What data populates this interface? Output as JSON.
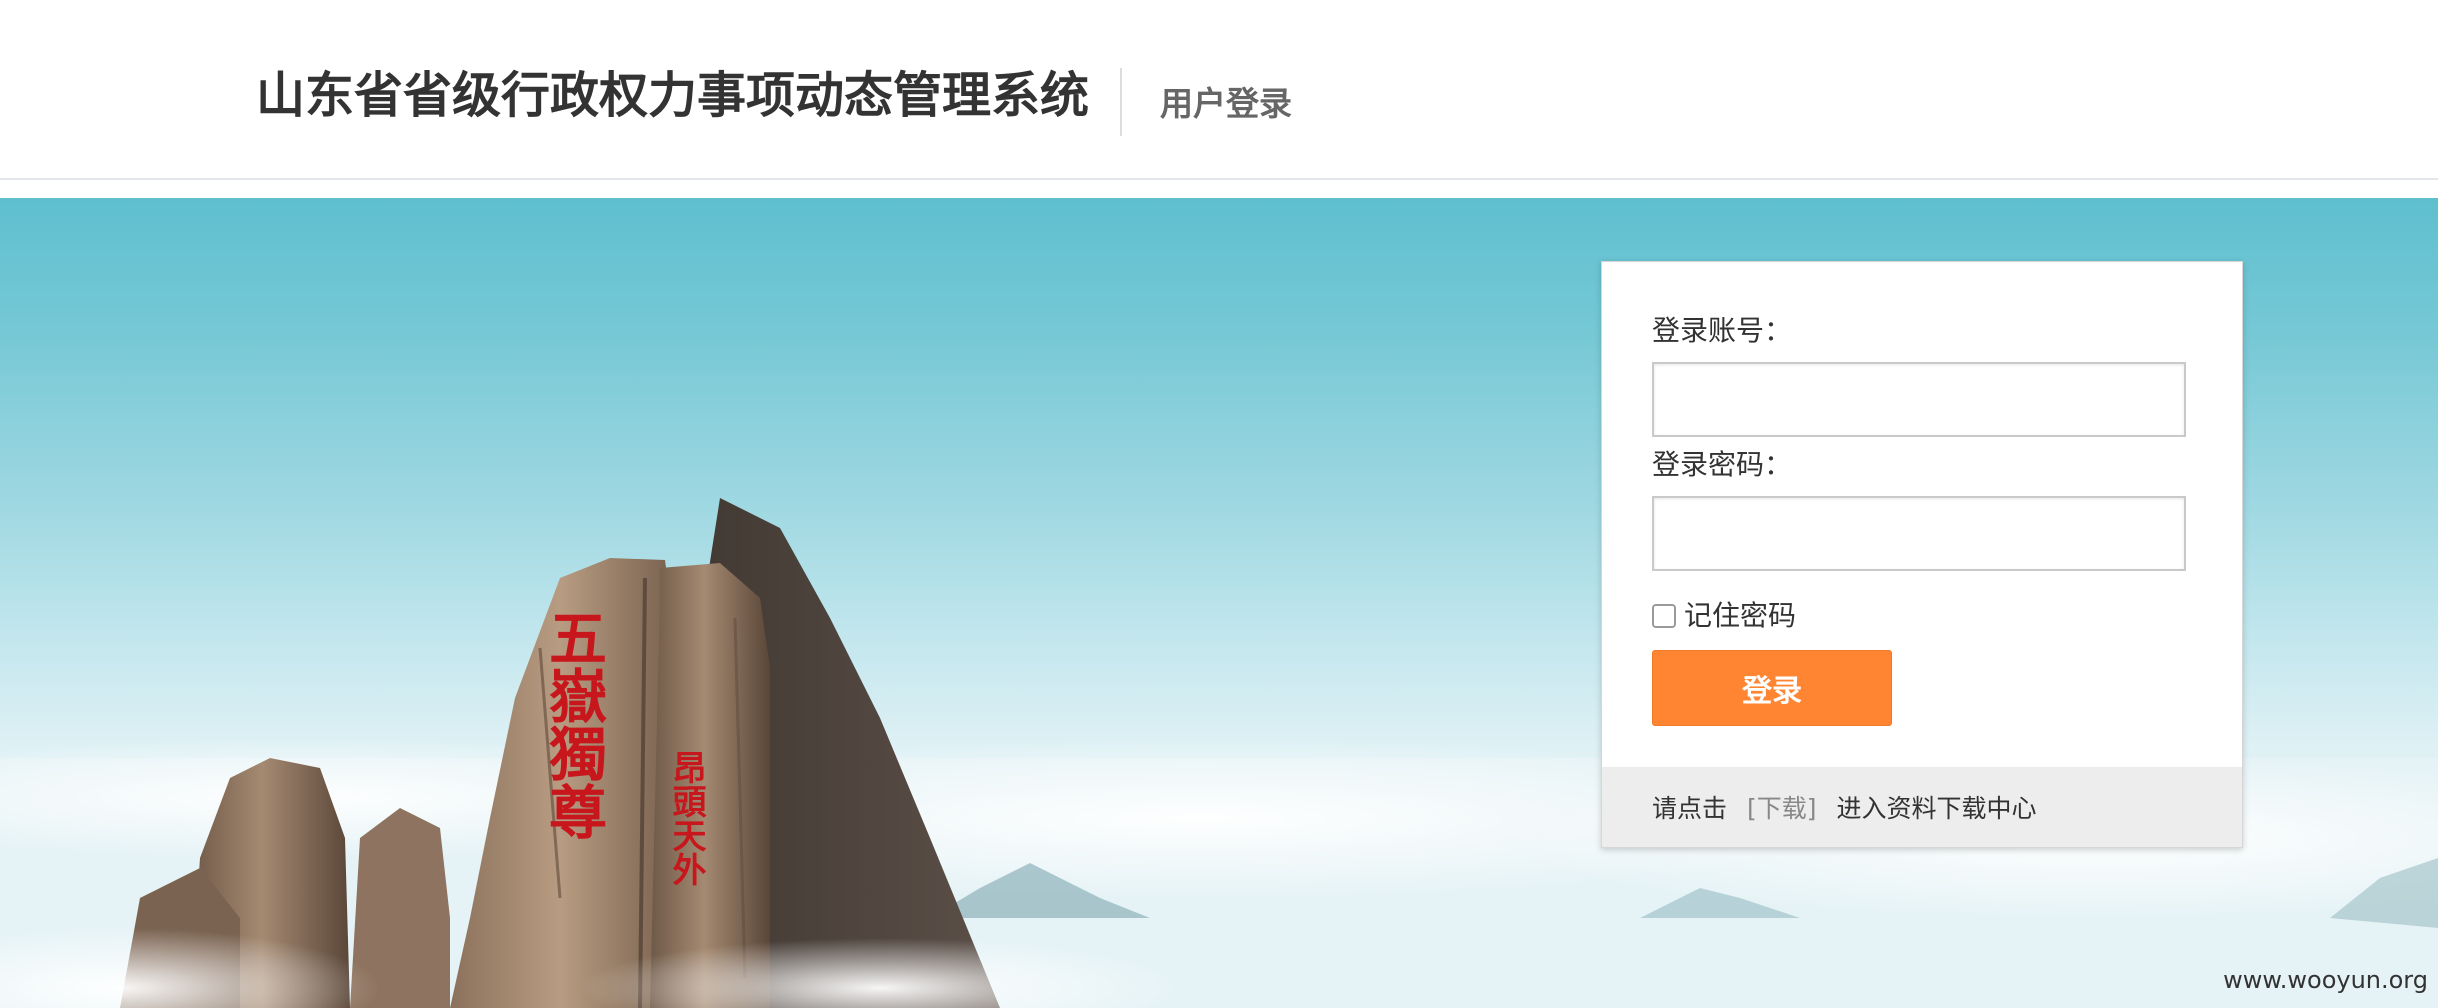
{
  "header": {
    "title": "山东省省级行政权力事项动态管理系统",
    "subtitle": "用户登录"
  },
  "login": {
    "account_label": "登录账号：",
    "account_value": "",
    "password_label": "登录密码：",
    "password_value": "",
    "remember_label": "记住密码",
    "remember_checked": false,
    "submit_label": "登录"
  },
  "footer": {
    "prefix": "请点击",
    "link_label": "[下载]",
    "suffix": "进入资料下载中心"
  },
  "banner": {
    "rock_inscription_main": "五嶽獨尊",
    "rock_inscription_side": "昂頭天外",
    "watermark": "www.wooyun.org"
  },
  "colors": {
    "accent": "#ff8533",
    "sky_top": "#5ebfcf",
    "footer_bg": "#ededed",
    "inscription_red": "#c8161d"
  }
}
